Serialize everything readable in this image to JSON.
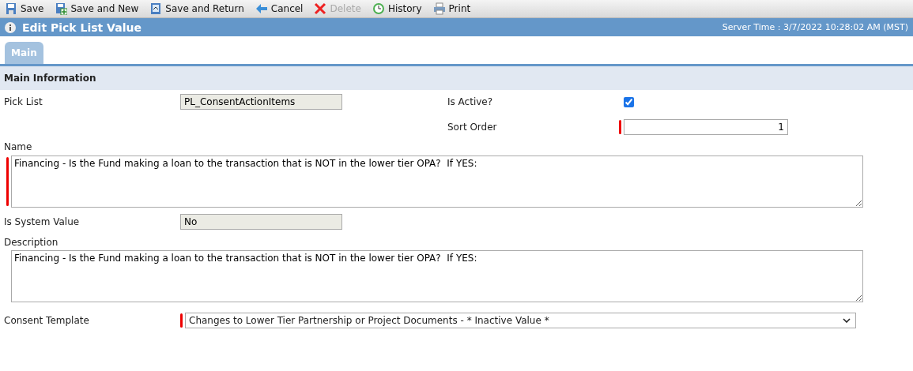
{
  "toolbar": [
    {
      "kind": "save",
      "label": "Save",
      "disabled": false
    },
    {
      "kind": "save-new",
      "label": "Save and New",
      "disabled": false
    },
    {
      "kind": "save-return",
      "label": "Save and Return",
      "disabled": false
    },
    {
      "kind": "cancel",
      "label": "Cancel",
      "disabled": false
    },
    {
      "kind": "delete",
      "label": "Delete",
      "disabled": true
    },
    {
      "kind": "history",
      "label": "History",
      "disabled": false
    },
    {
      "kind": "print",
      "label": "Print",
      "disabled": false
    }
  ],
  "header": {
    "title": "Edit Pick List Value",
    "server_time": "Server Time : 3/7/2022 10:28:02 AM (MST)"
  },
  "tabs": [
    {
      "label": "Main",
      "selected": true
    }
  ],
  "section": {
    "title": "Main Information"
  },
  "fields": {
    "pick_list": {
      "label": "Pick List",
      "value": "PL_ConsentActionItems",
      "readonly": true
    },
    "is_active": {
      "label": "Is Active?",
      "checked": true
    },
    "sort_order": {
      "label": "Sort Order",
      "value": "1",
      "required": true
    },
    "name": {
      "label": "Name",
      "value": "Financing - Is the Fund making a loan to the transaction that is NOT in the lower tier OPA?  If YES:",
      "required": true
    },
    "is_system_value": {
      "label": "Is System Value",
      "value": "No",
      "readonly": true
    },
    "description": {
      "label": "Description",
      "value": "Financing - Is the Fund making a loan to the transaction that is NOT in the lower tier OPA?  If YES:",
      "required": false
    },
    "consent_template": {
      "label": "Consent Template",
      "value": "Changes to Lower Tier Partnership or Project Documents - * Inactive Value *",
      "required": true
    }
  }
}
